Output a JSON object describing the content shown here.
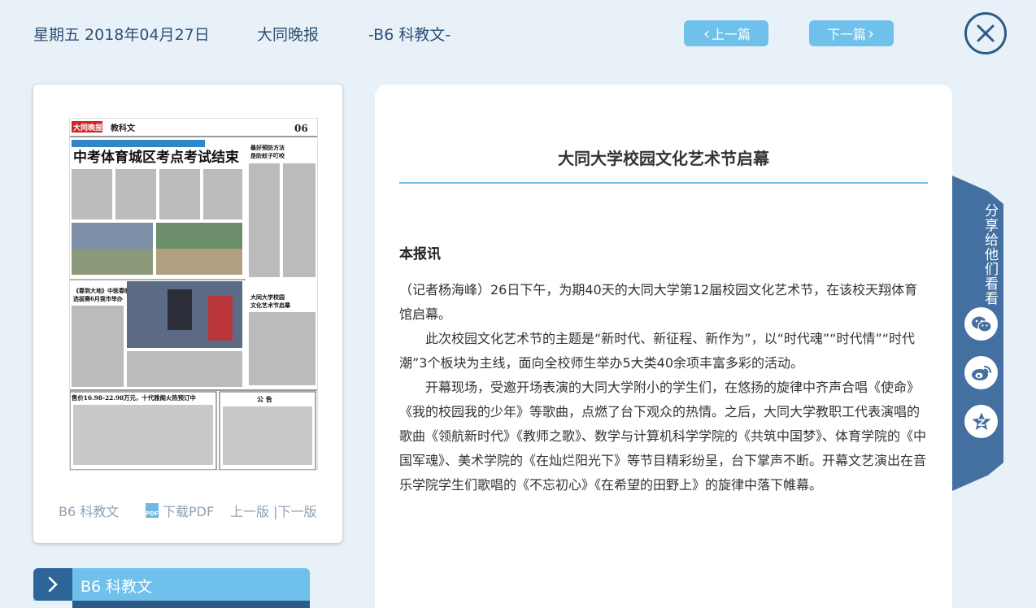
{
  "header": {
    "date": "星期五 2018年04月27日",
    "paper_name": "大同晚报",
    "page_name": "-B6 科教文-",
    "prev_label": "上一篇",
    "next_label": "下一篇"
  },
  "thumbnail": {
    "page_label": "B6 科教文",
    "pdf_label": "下载PDF",
    "prev_page_label": "上一版",
    "separator": "|",
    "next_page_label": "下一版",
    "newspaper": {
      "masthead": "大同晚报",
      "section": "教科文",
      "page_no": "06",
      "headline": "中考体育城区考点考试结束",
      "side_headline_1": "最好预防方法",
      "side_headline_2": "是防蚊子叮咬",
      "story2_line1": "《春到大地》中医春晚",
      "story2_line2": "选拔赛6月我市举办",
      "story3_line1": "大同大学校园",
      "story3_line2": "文化艺术节启幕",
      "ad_headline": "售价16.98-22.98万元，十代雅阁火热预订中",
      "notice": "公 告"
    }
  },
  "section_bar": {
    "label": "B6 科教文"
  },
  "article": {
    "title": "大同大学校园文化艺术节启幕",
    "byline": "本报讯",
    "paragraphs": [
      "（记者杨海峰）26日下午，为期40天的大同大学第12届校园文化艺术节，在该校天翔体育馆启幕。",
      "此次校园文化艺术节的主题是“新时代、新征程、新作为”，以“时代魂”“时代情”“时代潮”3个板块为主线，面向全校师生举办5大类40余项丰富多彩的活动。",
      "开幕现场，受邀开场表演的大同大学附小的学生们，在悠扬的旋律中齐声合唱《使命》《我的校园我的少年》等歌曲，点燃了台下观众的热情。之后，大同大学教职工代表演唱的歌曲《领航新时代》《教师之歌》、数学与计算机科学学院的《共筑中国梦》、体育学院的《中国军魂》、美术学院的《在灿烂阳光下》等节目精彩纷呈，台下掌声不断。开幕文艺演出在音乐学院学生们歌唱的《不忘初心》《在希望的田野上》的旋律中落下帷幕。"
    ]
  },
  "share": {
    "title": "分享给他们看看",
    "icons": [
      "wechat-icon",
      "weibo-icon",
      "favorite-star-icon"
    ]
  },
  "colors": {
    "accent": "#6fc0ea",
    "dark_blue": "#2d5a86",
    "share_panel": "#4370a0",
    "background": "#e9f1f8"
  }
}
